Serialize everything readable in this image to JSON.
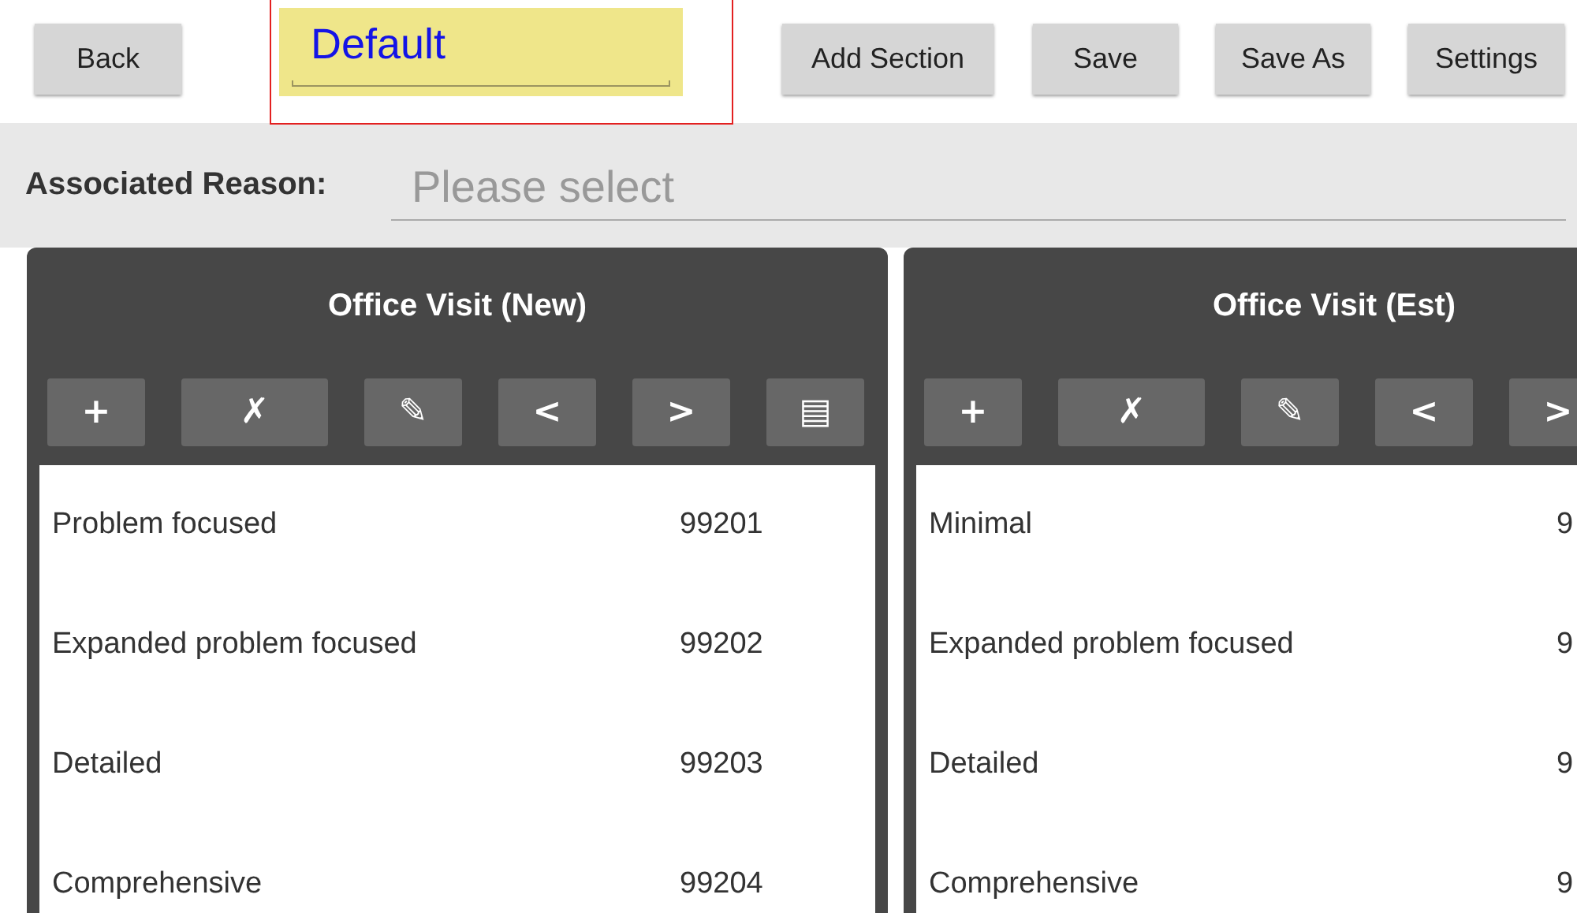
{
  "toolbar": {
    "back": "Back",
    "title_field": {
      "value": "Default",
      "highlighted": true
    },
    "buttons": [
      "Add Section",
      "Save",
      "Save As",
      "Settings"
    ]
  },
  "reason": {
    "label": "Associated Reason:",
    "placeholder": "Please select"
  },
  "sections": [
    {
      "title": "Office Visit (New)",
      "tools": [
        "+",
        "✗",
        "✎",
        "<",
        ">",
        "▤"
      ],
      "rows": [
        {
          "name": "Problem focused",
          "code": "99201"
        },
        {
          "name": "Expanded problem focused",
          "code": "99202"
        },
        {
          "name": "Detailed",
          "code": "99203"
        },
        {
          "name": "Comprehensive",
          "code": "99204"
        }
      ]
    },
    {
      "title": "Office Visit (Est)",
      "tools": [
        "+",
        "✗",
        "✎",
        "<",
        ">"
      ],
      "rows": [
        {
          "name": "Minimal",
          "code": "9"
        },
        {
          "name": "Expanded problem focused",
          "code": "9"
        },
        {
          "name": "Detailed",
          "code": "9"
        },
        {
          "name": "Comprehensive",
          "code": "9"
        }
      ]
    }
  ]
}
